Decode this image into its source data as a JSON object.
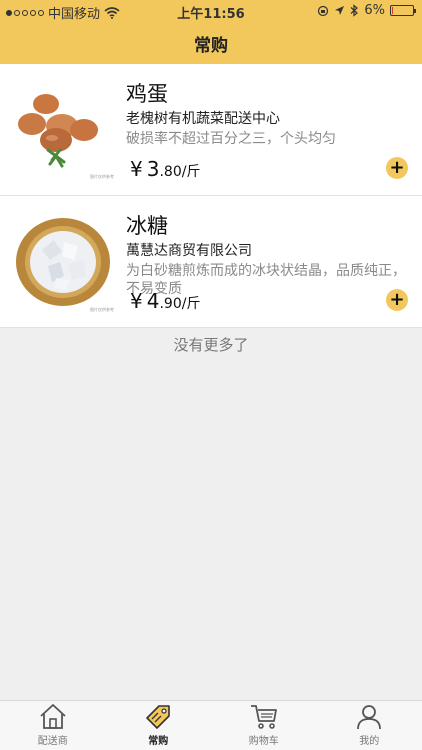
{
  "status": {
    "carrier": "中国移动",
    "time": "上午11:56",
    "battery": "6%",
    "battery_level": 0.06
  },
  "nav": {
    "title": "常购"
  },
  "items": [
    {
      "name": "鸡蛋",
      "supplier": "老槐树有机蔬菜配送中心",
      "description": "破损率不超过百分之三，个头均匀",
      "currency": "¥",
      "price_int": "3",
      "price_dec": ".80",
      "unit": "/斤"
    },
    {
      "name": "冰糖",
      "supplier": "萬慧达商贸有限公司",
      "description": "为白砂糖煎炼而成的冰块状结晶，品质纯正，不易变质",
      "currency": "¥",
      "price_int": "4",
      "price_dec": ".90",
      "unit": "/斤"
    }
  ],
  "footer_note": "没有更多了",
  "tabs": [
    {
      "label": "配送商",
      "icon": "home-icon"
    },
    {
      "label": "常购",
      "icon": "tag-icon"
    },
    {
      "label": "购物车",
      "icon": "cart-icon"
    },
    {
      "label": "我的",
      "icon": "user-icon"
    }
  ],
  "colors": {
    "accent": "#f2c75c",
    "background": "#efefef"
  }
}
